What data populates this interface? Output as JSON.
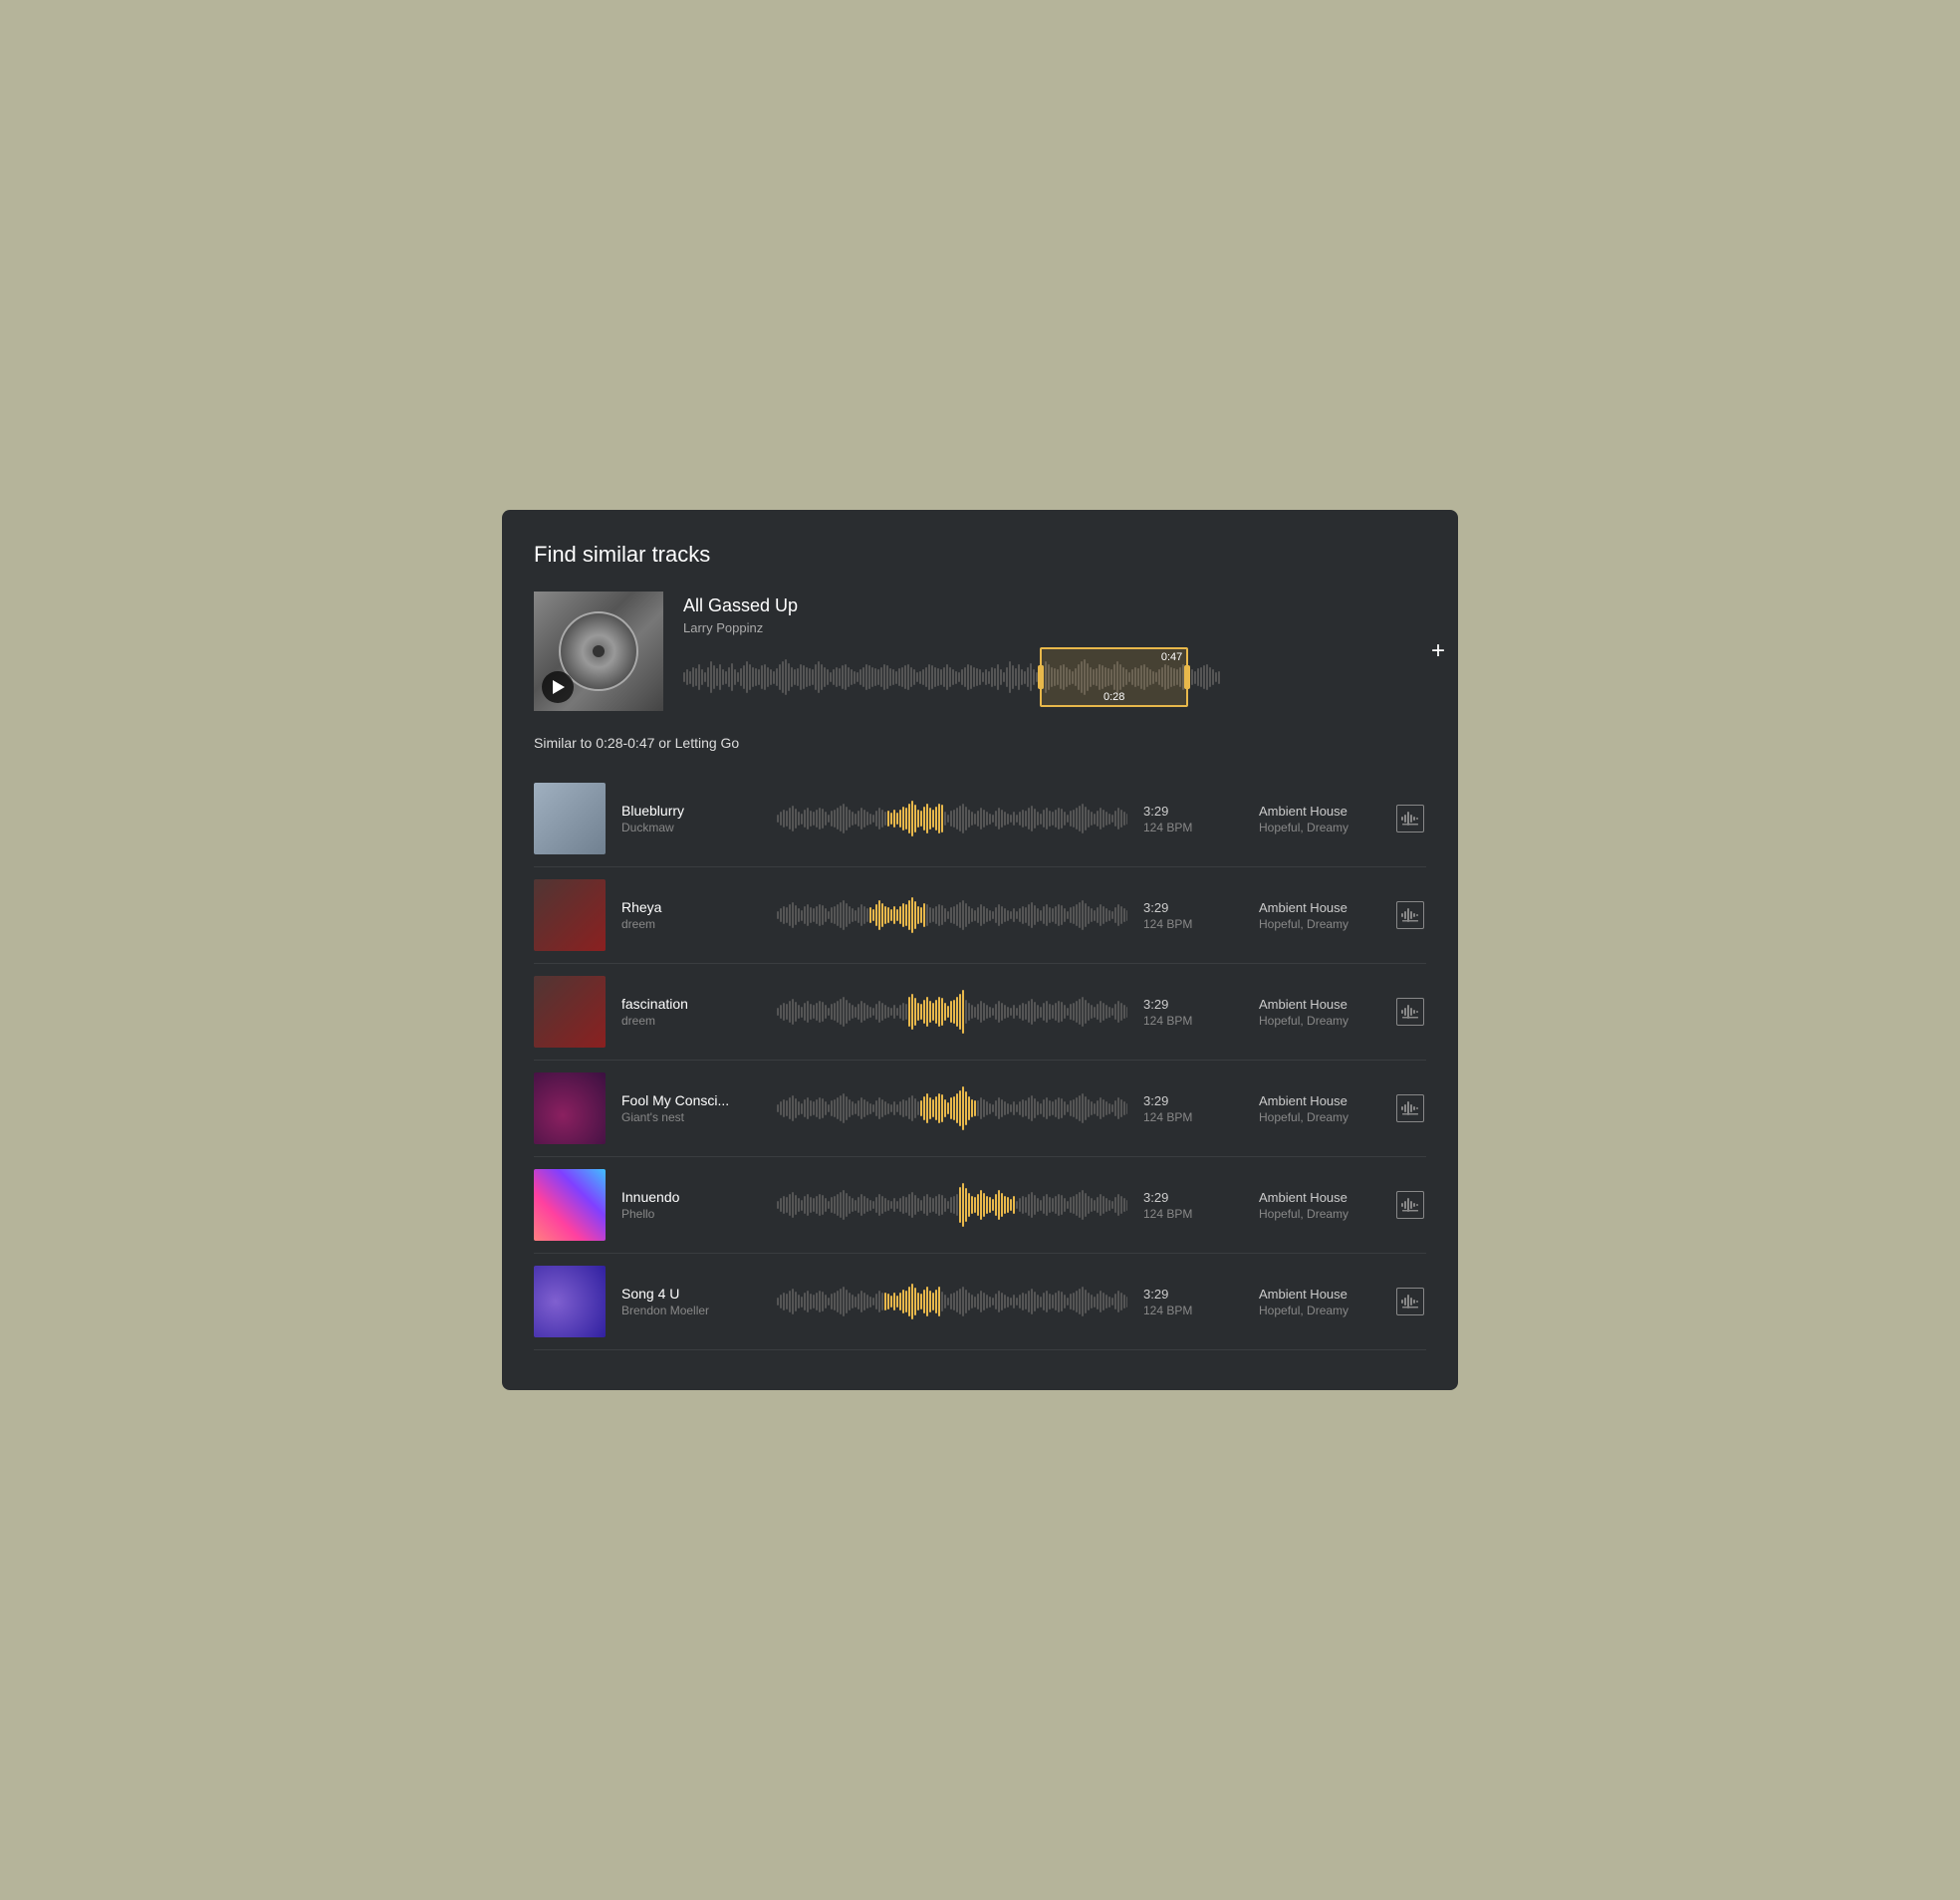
{
  "panel": {
    "title": "Find similar tracks",
    "add_label": "+"
  },
  "source_track": {
    "title": "All Gassed Up",
    "artist": "Larry Poppinz",
    "play_label": "▶",
    "selection_start": "0:28",
    "selection_end": "0:47"
  },
  "similar_label": "Similar to 0:28-0:47 or Letting Go",
  "tracks": [
    {
      "name": "Blueblurry",
      "artist": "Duckmaw",
      "duration": "3:29",
      "bpm": "124 BPM",
      "genre": "Ambient House",
      "mood": "Hopeful, Dreamy",
      "art_class": "track-art-1",
      "highlight_pos": 0.38
    },
    {
      "name": "Rheya",
      "artist": "dreem",
      "duration": "3:29",
      "bpm": "124 BPM",
      "genre": "Ambient House",
      "mood": "Hopeful, Dreamy",
      "art_class": "track-art-2",
      "highlight_pos": 0.33
    },
    {
      "name": "fascination",
      "artist": "dreem",
      "duration": "3:29",
      "bpm": "124 BPM",
      "genre": "Ambient House",
      "mood": "Hopeful, Dreamy",
      "art_class": "track-art-3",
      "highlight_pos": 0.44
    },
    {
      "name": "Fool My Consci...",
      "artist": "Giant's nest",
      "duration": "3:29",
      "bpm": "124 BPM",
      "genre": "Ambient House",
      "mood": "Hopeful, Dreamy",
      "art_class": "track-art-4",
      "highlight_pos": 0.47
    },
    {
      "name": "Innuendo",
      "artist": "Phello",
      "duration": "3:29",
      "bpm": "124 BPM",
      "genre": "Ambient House",
      "mood": "Hopeful, Dreamy",
      "art_class": "track-art-5",
      "highlight_pos": 0.58
    },
    {
      "name": "Song 4 U",
      "artist": "Brendon Moeller",
      "duration": "3:29",
      "bpm": "124 BPM",
      "genre": "Ambient House",
      "mood": "Hopeful, Dreamy",
      "art_class": "track-art-6",
      "highlight_pos": 0.37
    }
  ]
}
